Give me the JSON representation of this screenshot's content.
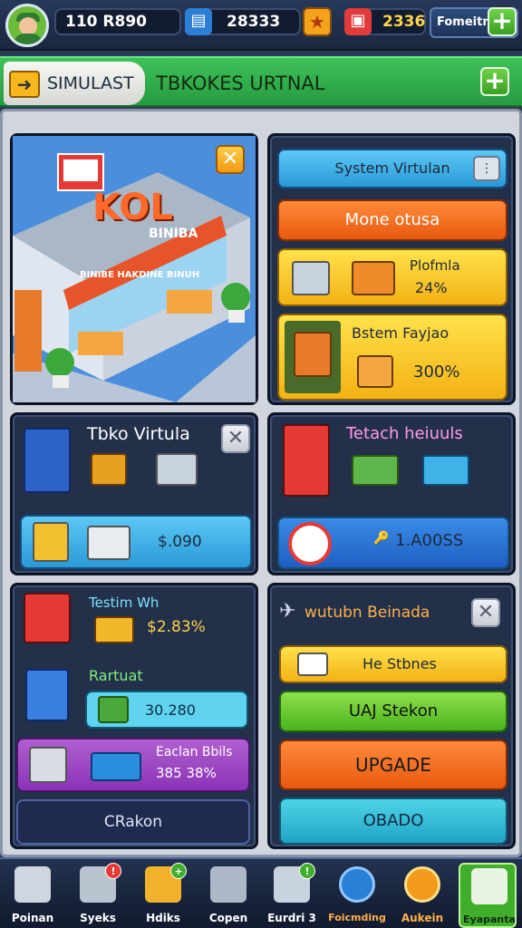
{
  "topbar": {
    "cash": "110 R890",
    "gems": "28333",
    "coins": "2336",
    "profile_label": "Fomeitre",
    "icons": [
      "avatar",
      "cash-icon",
      "gem-icon",
      "star-icon",
      "gift-icon",
      "plus-icon"
    ]
  },
  "titlebar": {
    "back_tab_label": "SIMULAST",
    "title": "TBKOKES URTNAL"
  },
  "store_panel": {
    "sign_big": "KOL",
    "sign_small": "BINIBA",
    "awning_text": "BINIBE HAKDINE BINUH"
  },
  "right_top": {
    "system_button": "System Virtulan",
    "orange_button": "Mone otusa",
    "card1_title": "Plofmla",
    "card1_value": "24%",
    "card2_title": "Bstem Fayjao",
    "card2_value": "300%"
  },
  "toko_panel": {
    "title": "Tbko Virtula",
    "price": "$.090"
  },
  "tetah_panel": {
    "title": "Tetach heiuuls",
    "value": "1.A00SS"
  },
  "left_bottom": {
    "testim_label": "Testim Wh",
    "testim_value": "$2.83%",
    "rartuat_label": "Rartuat",
    "rartuat_value": "30.280",
    "purple_title": "Eaclan Bbils",
    "purple_value": "385 38%",
    "navy_button": "CRakon"
  },
  "right_bottom": {
    "title": "wutubn Beinada",
    "yellow_button": "He Stbnes",
    "green_button": "UAJ Stekon",
    "upgrade_button": "UPGADE",
    "cyan_button": "OBADO"
  },
  "nav": [
    {
      "label": "Poinan",
      "icon": "home-icon"
    },
    {
      "label": "Syeks",
      "icon": "calculator-icon",
      "badge": "!"
    },
    {
      "label": "Hdiks",
      "icon": "mail-icon",
      "badge": "+"
    },
    {
      "label": "Copen",
      "icon": "cash-register-icon"
    },
    {
      "label": "Eurdri 3",
      "icon": "shop-icon",
      "badge": "!"
    },
    {
      "label": "Foicmding",
      "icon": "gear-icon"
    },
    {
      "label": "Aukein",
      "icon": "basket-icon"
    },
    {
      "label": "Eyapanta",
      "icon": "edit-icon"
    }
  ],
  "colors": {
    "accent_green": "#3ec15a",
    "panel_navy": "#22304a",
    "orange": "#e85a10",
    "yellow": "#f3b214"
  }
}
